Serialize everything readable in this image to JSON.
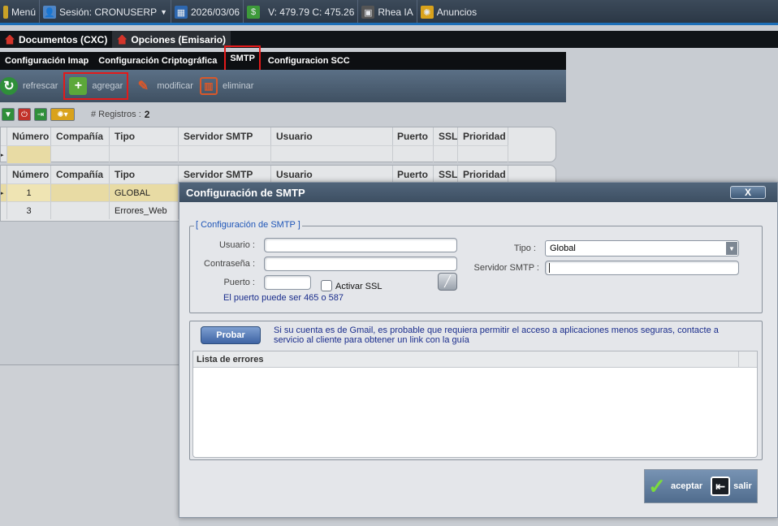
{
  "topbar": {
    "menu": "Menú",
    "session": "Sesión: CRONUSERP",
    "date": "2026/03/06",
    "balance": "V: 479.79 C: 475.26",
    "ai": "Rhea IA",
    "ads": "Anuncios"
  },
  "doc_tabs": [
    "Documentos (CXC)",
    "Opciones (Emisario)"
  ],
  "sub_tabs": [
    "Configuración Imap",
    "Configuración Criptográfica",
    "SMTP",
    "Configuracion SCC"
  ],
  "toolbar": {
    "refresh": "refrescar",
    "add": "agregar",
    "edit": "modificar",
    "delete": "eliminar"
  },
  "registros": {
    "label": "# Registros :",
    "count": "2"
  },
  "grid": {
    "columns": [
      "Número",
      "Compañía",
      "Tipo",
      "Servidor SMTP",
      "Usuario",
      "Puerto",
      "SSL",
      "Prioridad"
    ],
    "rows": [
      {
        "numero": "1",
        "compania": "",
        "tipo": "GLOBAL"
      },
      {
        "numero": "3",
        "compania": "",
        "tipo": "Errores_Web"
      }
    ]
  },
  "dialog": {
    "title": "Configuración de SMTP",
    "close": "X",
    "legend": "[ Configuración de SMTP ]",
    "user_label": "Usuario :",
    "user_value": "",
    "password_label": "Contraseña :",
    "password_value": "",
    "port_label": "Puerto :",
    "port_value": "",
    "ssl_label": "Activar SSL",
    "port_hint": "El puerto puede ser 465 o 587",
    "type_label": "Tipo :",
    "type_value": "Global",
    "server_label": "Servidor SMTP :",
    "server_value": "",
    "test_button": "Probar",
    "gmail_hint": "Si su cuenta es de Gmail, es probable que requiera permitir el acceso a aplicaciones menos seguras, contacte a servicio al cliente para obtener un link con la guía",
    "errors_header": "Lista de errores",
    "accept": "aceptar",
    "exit": "salir"
  },
  "colors": {
    "accent": "#1d6fb8",
    "highlight": "#e31a1a",
    "selected_row": "#e8dba4"
  }
}
